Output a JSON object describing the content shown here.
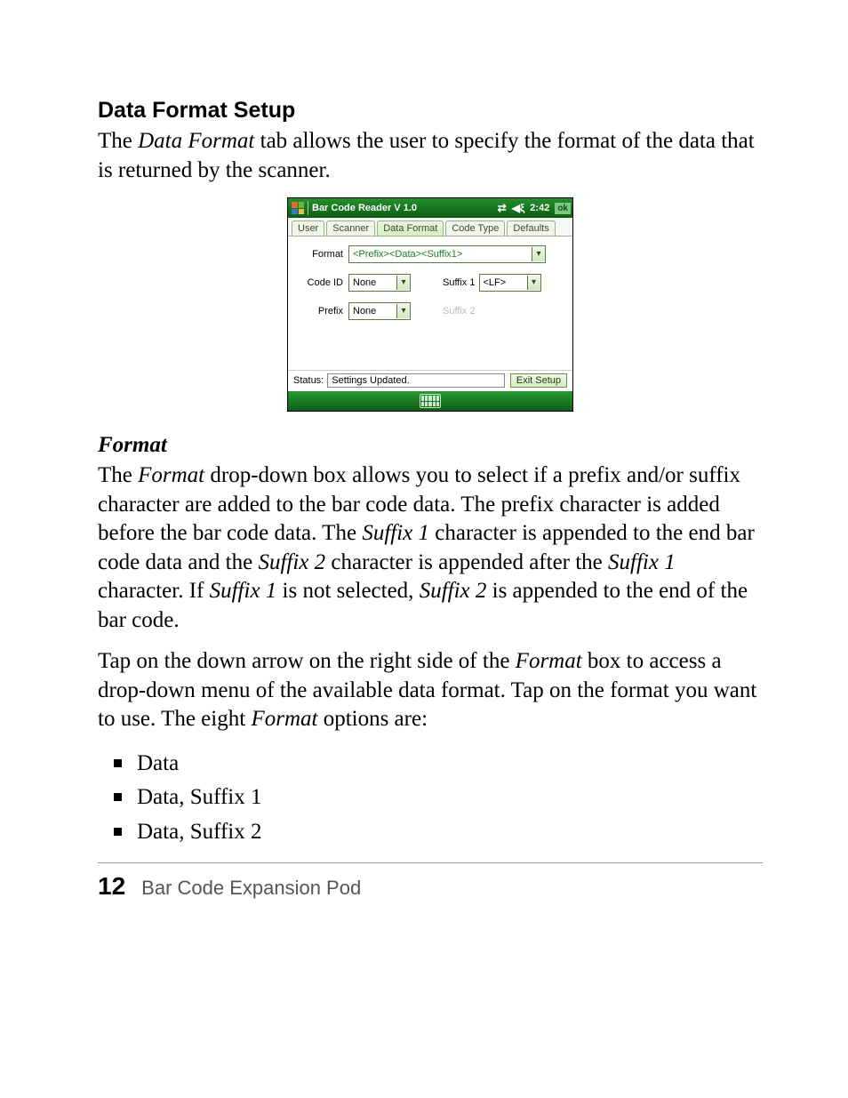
{
  "section_heading": "Data Format Setup",
  "intro_text_pre": "The ",
  "intro_text_em": "Data Format",
  "intro_text_post": " tab allows the user to specify the format of the data that is returned by the scanner.",
  "device": {
    "title": "Bar Code Reader V 1.0",
    "clock": "2:42",
    "ok": "ok",
    "tabs": {
      "user": "User",
      "scanner": "Scanner",
      "data_format": "Data Format",
      "code_type": "Code Type",
      "defaults": "Defaults"
    },
    "labels": {
      "format": "Format",
      "code_id": "Code ID",
      "prefix": "Prefix",
      "suffix1": "Suffix 1",
      "suffix2": "Suffix 2",
      "status": "Status:"
    },
    "values": {
      "format": "<Prefix><Data><Suffix1>",
      "code_id": "None",
      "prefix": "None",
      "suffix1": "<LF>"
    },
    "status_value": "Settings Updated.",
    "exit_button": "Exit Setup"
  },
  "sub_heading": "Format",
  "para2_parts": {
    "a": "The ",
    "b": "Format",
    "c": " drop-down box allows you to select if a prefix and/or suffix character are added to the bar code data. The prefix character is added before the bar code data. The ",
    "d": "Suffix 1",
    "e": " character is appended to the end bar code data and the ",
    "f": "Suffix 2",
    "g": " character is appended after the ",
    "h": "Suffix 1",
    "i": " character. If ",
    "j": "Suffix 1",
    "k": " is not selected, ",
    "l": "Suffix 2",
    "m": " is appended to the end of the bar code."
  },
  "para3_parts": {
    "a": "Tap on the down arrow on the right side of the ",
    "b": "Format",
    "c": " box to access a drop-down menu of the available data format. Tap on the format you want to use. The eight ",
    "d": "Format",
    "e": " options are:"
  },
  "options": [
    "Data",
    "Data, Suffix 1",
    "Data, Suffix 2"
  ],
  "footer": {
    "page": "12",
    "title": "Bar Code Expansion Pod"
  }
}
